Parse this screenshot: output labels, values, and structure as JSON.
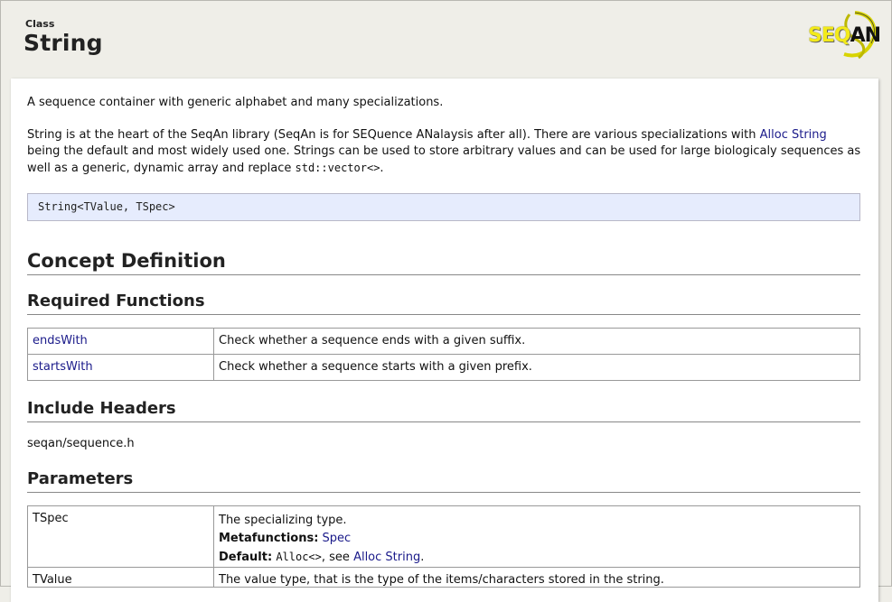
{
  "header": {
    "kicker": "Class",
    "title": "String",
    "logo_text_seq": "SEQ",
    "logo_text_an": "AN"
  },
  "intro": {
    "lead": "A sequence container with generic alphabet and many specializations.",
    "desc_part1": "String is at the heart of the SeqAn library (SeqAn is for SEQuence ANalaysis after all). There are various specializations with ",
    "desc_link": "Alloc String",
    "desc_part2": " being the default and most widely used one. Strings can be used to store arbitrary values and can be used for large biologicaly sequences as well as a generic, dynamic array and replace ",
    "desc_code": "std::vector<>",
    "desc_part3": "."
  },
  "signature": "String<TValue, TSpec>",
  "sections": {
    "concept_definition": "Concept Definition",
    "required_functions": "Required Functions",
    "include_headers": "Include Headers",
    "parameters": "Parameters"
  },
  "required_functions": [
    {
      "name": "endsWith",
      "desc": "Check whether a sequence ends with a given suffix."
    },
    {
      "name": "startsWith",
      "desc": "Check whether a sequence starts with a given prefix."
    }
  ],
  "include_header": "seqan/sequence.h",
  "parameters": [
    {
      "name": "TSpec",
      "desc": "The specializing type.",
      "metafunctions_label": "Metafunctions:",
      "metafunctions_link": "Spec",
      "default_label": "Default:",
      "default_code": "Alloc<>",
      "default_sep": ", see ",
      "default_link": "Alloc String",
      "default_end": "."
    },
    {
      "name": "TValue",
      "desc": "The value type, that is the type of the items/characters stored in the string."
    }
  ],
  "colors": {
    "background": "#efeee8",
    "link": "#1a1a8a",
    "signature_bg": "#e6ecfd",
    "logo_yellow": "#f3ea1a"
  }
}
